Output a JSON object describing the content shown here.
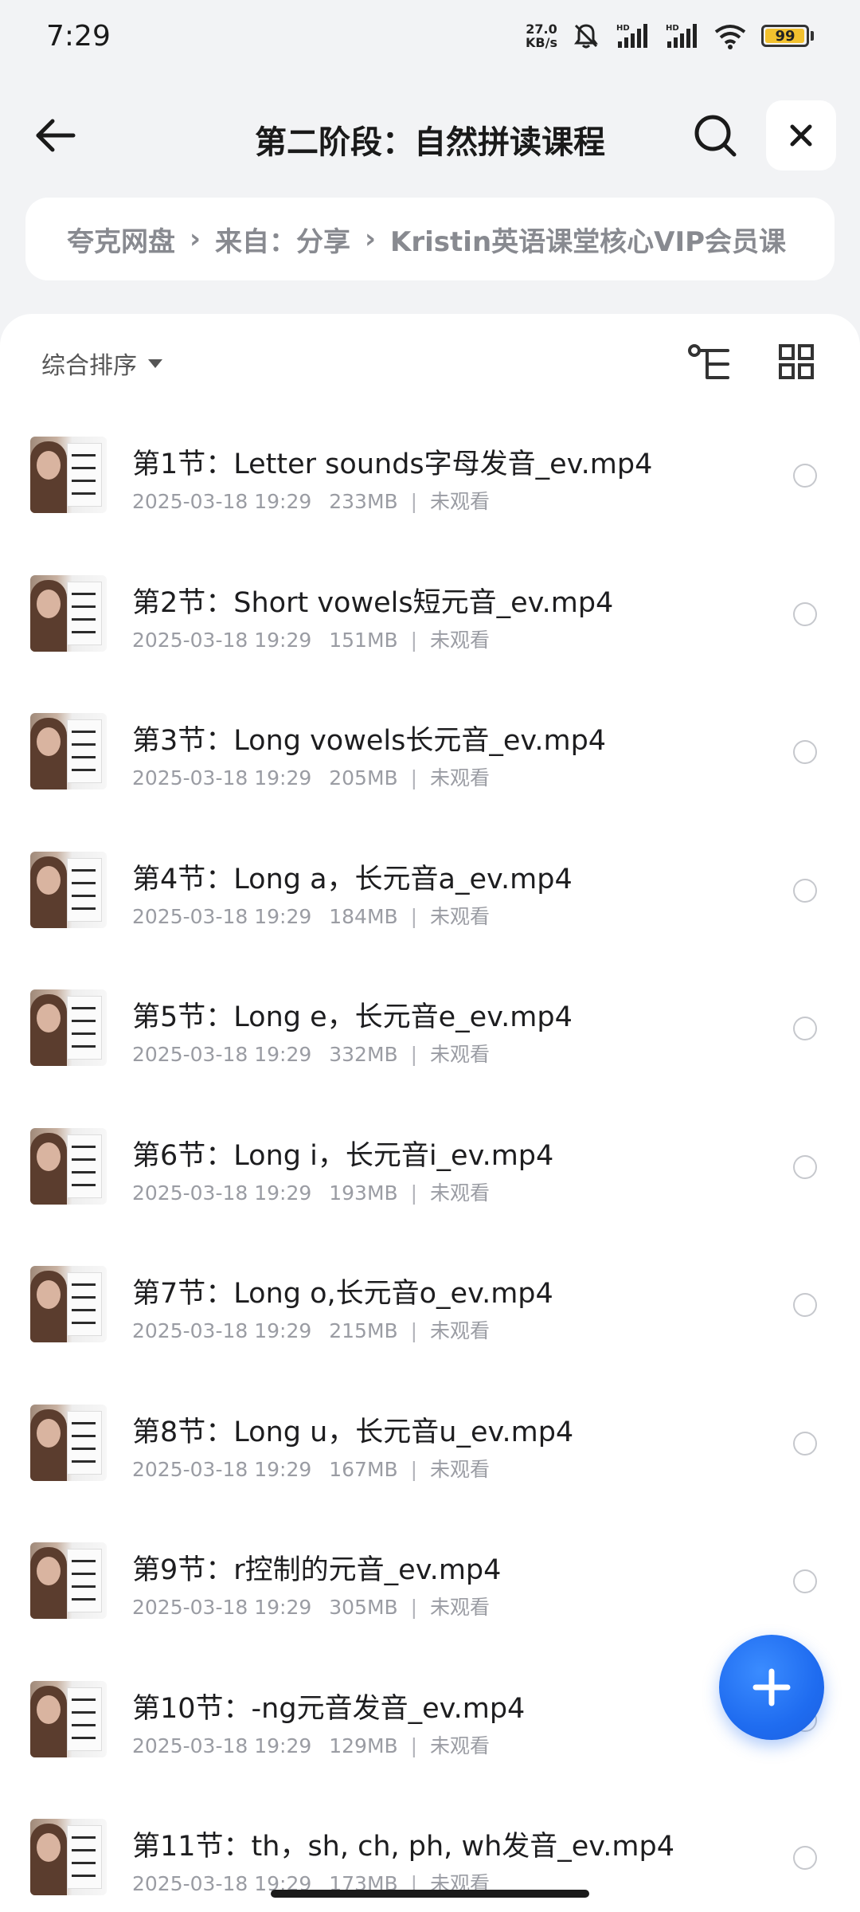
{
  "status_bar": {
    "time": "7:29",
    "net_speed_value": "27.0",
    "net_speed_unit": "KB/s",
    "battery": "99",
    "battery_level": 0.99,
    "icons": [
      "mute-bell-icon",
      "signal-hd-icon",
      "signal-hd-icon",
      "wifi-icon",
      "battery-icon"
    ]
  },
  "header": {
    "title": "第二阶段：自然拼读课程",
    "back_icon": "arrow-left-icon",
    "search_icon": "search-icon",
    "close_icon": "close-icon"
  },
  "breadcrumb": {
    "items": [
      "夸克网盘",
      "来自：分享",
      "Kristin英语课堂核心VIP会员课"
    ],
    "separator": "›"
  },
  "toolbar": {
    "sort_label": "综合排序",
    "tree_icon": "tree-view-icon",
    "grid_icon": "grid-view-icon"
  },
  "files": [
    {
      "name": "第1节：Letter sounds字母发音_ev.mp4",
      "date": "2025-03-18 19:29",
      "size": "233MB",
      "status": "未观看"
    },
    {
      "name": "第2节：Short vowels短元音_ev.mp4",
      "date": "2025-03-18 19:29",
      "size": "151MB",
      "status": "未观看"
    },
    {
      "name": "第3节：Long vowels长元音_ev.mp4",
      "date": "2025-03-18 19:29",
      "size": "205MB",
      "status": "未观看"
    },
    {
      "name": "第4节：Long a，长元音a_ev.mp4",
      "date": "2025-03-18 19:29",
      "size": "184MB",
      "status": "未观看"
    },
    {
      "name": "第5节：Long e，长元音e_ev.mp4",
      "date": "2025-03-18 19:29",
      "size": "332MB",
      "status": "未观看"
    },
    {
      "name": "第6节：Long i，长元音i_ev.mp4",
      "date": "2025-03-18 19:29",
      "size": "193MB",
      "status": "未观看"
    },
    {
      "name": "第7节：Long o,长元音o_ev.mp4",
      "date": "2025-03-18 19:29",
      "size": "215MB",
      "status": "未观看"
    },
    {
      "name": "第8节：Long u，长元音u_ev.mp4",
      "date": "2025-03-18 19:29",
      "size": "167MB",
      "status": "未观看"
    },
    {
      "name": "第9节：r控制的元音_ev.mp4",
      "date": "2025-03-18 19:29",
      "size": "305MB",
      "status": "未观看"
    },
    {
      "name": "第10节：-ng元音发音_ev.mp4",
      "date": "2025-03-18 19:29",
      "size": "129MB",
      "status": "未观看"
    },
    {
      "name": "第11节：th，sh, ch, ph, wh发音_ev.mp4",
      "date": "2025-03-18 19:29",
      "size": "173MB",
      "status": "未观看"
    }
  ],
  "fab": {
    "icon": "plus-icon"
  },
  "colors": {
    "accent": "#1f6cf0",
    "battery": "#f2c12e",
    "meta_text": "#9a9ca3",
    "breadcrumb_text": "#888a90"
  }
}
